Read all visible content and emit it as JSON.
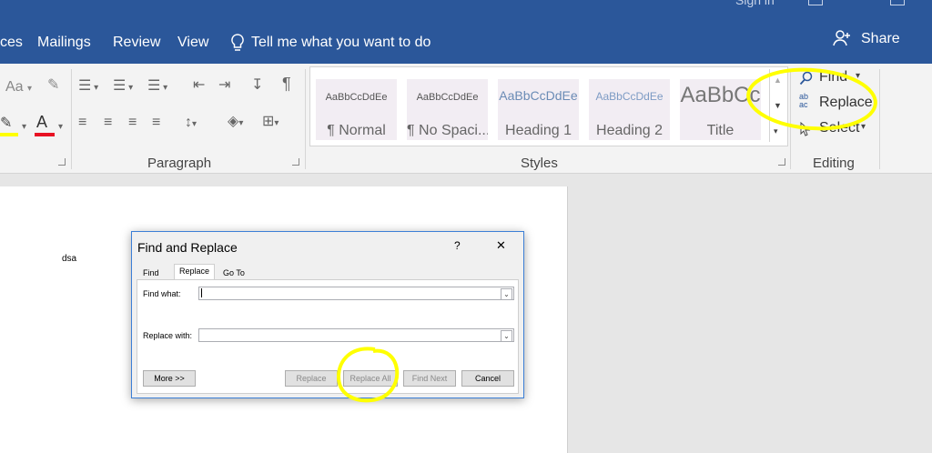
{
  "window": {
    "signin_label": "Sign in",
    "share_label": "Share",
    "tell_me": "Tell me what you want to do"
  },
  "tabs": [
    {
      "label": "ces"
    },
    {
      "label": "Mailings"
    },
    {
      "label": "Review"
    },
    {
      "label": "View"
    }
  ],
  "ribbon": {
    "font_group": {
      "font_size_glyph": "Aa",
      "font_color_glyph": "A"
    },
    "paragraph_label": "Paragraph",
    "styles_label": "Styles",
    "editing_label": "Editing",
    "styles": [
      {
        "preview": "AaBbCcDdEe",
        "name": "¶ Normal"
      },
      {
        "preview": "AaBbCcDdEe",
        "name": "¶ No Spaci..."
      },
      {
        "preview": "AaBbCcDdEe",
        "name": "Heading 1"
      },
      {
        "preview": "AaBbCcDdEe",
        "name": "Heading 2"
      },
      {
        "preview": "AaBbCc",
        "name": "Title"
      }
    ],
    "editing": {
      "find_label": "Find",
      "replace_label": "Replace",
      "select_label": "Select"
    }
  },
  "document": {
    "text": "dsa"
  },
  "dialog": {
    "title": "Find and Replace",
    "help_glyph": "?",
    "close_glyph": "✕",
    "tabs": [
      "Find",
      "Replace",
      "Go To"
    ],
    "active_tab": "Replace",
    "find_what_label": "Find what:",
    "find_what_value": "",
    "replace_with_label": "Replace with:",
    "replace_with_value": "",
    "buttons": {
      "more": "More >>",
      "replace": "Replace",
      "replace_all": "Replace All",
      "find_next": "Find Next",
      "cancel": "Cancel"
    }
  },
  "colors": {
    "title_bar": "#2b579a",
    "highlight": "#ffff00",
    "font_color": "#e81123",
    "dialog_border": "#3c7fd6"
  }
}
